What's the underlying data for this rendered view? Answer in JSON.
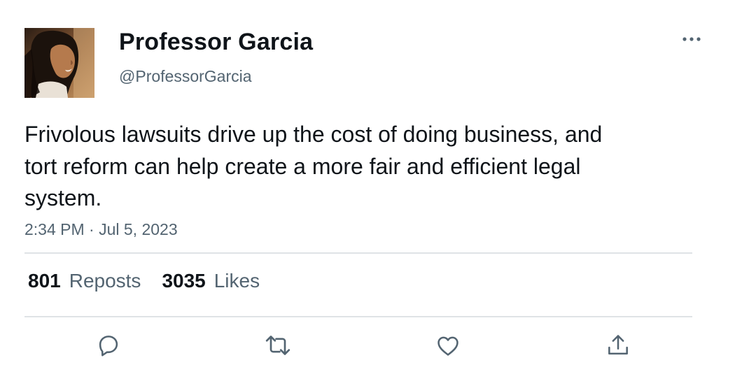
{
  "user": {
    "display_name": "Professor Garcia",
    "handle": "@ProfessorGarcia"
  },
  "tweet": {
    "text": "Frivolous lawsuits drive up the cost of doing business, and tort reform can help create a more fair and efficient legal system.",
    "timestamp": "2:34 PM · Jul 5, 2023"
  },
  "stats": {
    "reposts_count": "801",
    "reposts_label": "Reposts",
    "likes_count": "3035",
    "likes_label": "Likes"
  },
  "icons": {
    "more": "more-horizontal-icon",
    "reply": "reply-icon",
    "repost": "repost-icon",
    "like": "heart-icon",
    "share": "share-icon"
  },
  "colors": {
    "text_primary": "#0f1419",
    "text_secondary": "#536471",
    "divider": "#dfe3e6"
  }
}
